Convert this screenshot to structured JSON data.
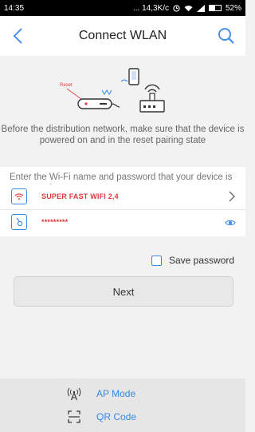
{
  "status_bar": {
    "time": "14:35",
    "net_speed": "... 14,3K/c",
    "battery": "52%",
    "battery_level": 0.52
  },
  "header": {
    "title": "Connect WLAN",
    "back_icon": "chevron-left-icon",
    "search_icon": "search-icon"
  },
  "illustration": {
    "reset_label": "Reset"
  },
  "description": "Before the distribution network, make sure that the device is powered on and in the reset pairing state",
  "form": {
    "hint": "Enter the Wi-Fi name and password that your device is connected to.",
    "wifi_name": "SUPER FAST WIFI 2,4",
    "password_masked": "*********",
    "save_password_label": "Save password",
    "save_password_checked": false
  },
  "next_button": "Next",
  "modes": {
    "ap_mode": "AP Mode",
    "qr_code": "QR Code"
  },
  "colors": {
    "accent": "#3a87e6",
    "danger": "#e0383c"
  }
}
